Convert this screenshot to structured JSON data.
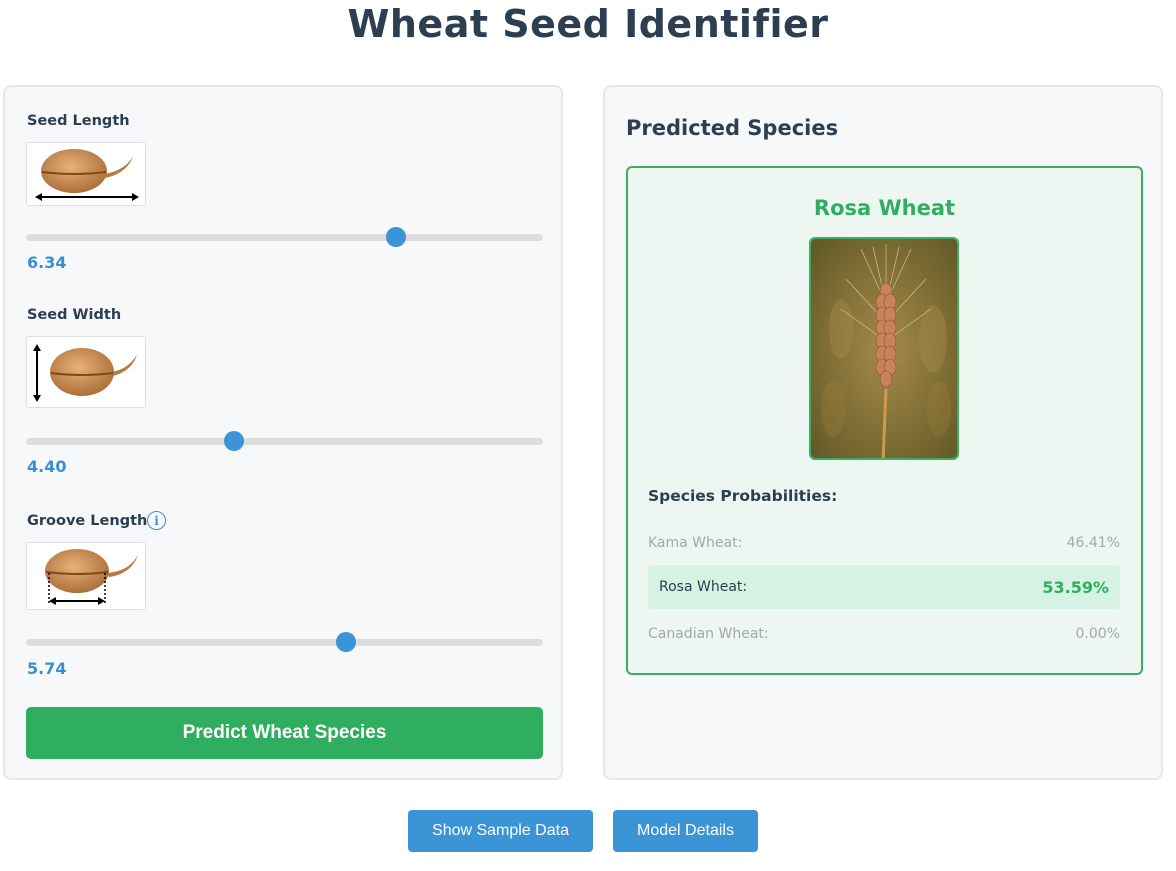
{
  "app": {
    "title": "Wheat Seed Identifier"
  },
  "inputs": {
    "seed_length": {
      "label": "Seed Length",
      "value": "6.34",
      "position": 0.715
    },
    "seed_width": {
      "label": "Seed Width",
      "value": "4.40",
      "position": 0.403
    },
    "groove_length": {
      "label": "Groove Length",
      "value": "5.74",
      "position": 0.618,
      "info_icon": "info-icon"
    }
  },
  "actions": {
    "predict_label": "Predict Wheat Species",
    "sample_label": "Show Sample Data",
    "details_label": "Model Details"
  },
  "prediction": {
    "heading": "Predicted Species",
    "species": "Rosa Wheat",
    "probabilities_heading": "Species Probabilities:",
    "probabilities": [
      {
        "label": "Kama Wheat:",
        "value": "46.41%"
      },
      {
        "label": "Rosa Wheat:",
        "value": "53.59%"
      },
      {
        "label": "Canadian Wheat:",
        "value": "0.00%"
      }
    ]
  },
  "colors": {
    "accent_blue": "#3a94d6",
    "accent_green": "#2fae5f",
    "title": "#2c3e50"
  }
}
